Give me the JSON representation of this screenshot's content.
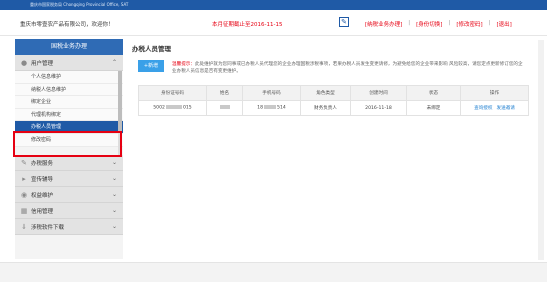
{
  "header": {
    "topbar_text": "重庆市国家税务局 Chongqing Provincial Office, SAT",
    "welcome": "重庆市零壹农产品有限公司，欢迎你！",
    "deadline": "本月征期截止至2016-11-15",
    "links": [
      "[纳税业务办理]",
      "[身份切换]",
      "[修改密码]",
      "[退出]"
    ]
  },
  "sidebar": {
    "title": "国税业务办理",
    "groups": [
      {
        "label": "用户管理",
        "icon": "user-icon",
        "expanded": true,
        "items": [
          "个人信息维护",
          "纳税人信息维护",
          "绑定企业",
          "代理机构绑定",
          "办税人员管理",
          "修改密码"
        ]
      },
      {
        "label": "办税服务",
        "icon": "pen-icon"
      },
      {
        "label": "宣传辅导",
        "icon": "megaphone-icon"
      },
      {
        "label": "权益维护",
        "icon": "shield-icon"
      },
      {
        "label": "信用管理",
        "icon": "credit-icon"
      },
      {
        "label": "涉税软件下载",
        "icon": "download-icon"
      }
    ],
    "active_item": "办税人员管理"
  },
  "main": {
    "title": "办税人员管理",
    "add_button": "+新增",
    "hint_label": "温馨提示：",
    "hint_text": "此处维护就为您同事或已办税人员代理您的企业办理国税涉税事项，若果办税人员发生变更请修，为避免给您的企业带来影响 风险较高，请您定点更新修订您的企业办税人员信息是否有变更维护。",
    "table": {
      "headers": [
        "身份证号码",
        "姓名",
        "手机号码",
        "角色类型",
        "创建时间",
        "状态",
        "操作"
      ],
      "rows": [
        {
          "id_prefix": "5002",
          "id_suffix": "015",
          "name": "",
          "phone_prefix": "18",
          "phone_suffix": "514",
          "role": "财务负责人",
          "created": "2016-11-18",
          "status": "未绑定",
          "ops": [
            "查询授权",
            "发送邀请"
          ]
        }
      ]
    }
  },
  "colors": {
    "brand": "#1f5aa6",
    "accent_red": "#e60012",
    "link": "#1f7fd0",
    "button": "#3aa0e8"
  }
}
